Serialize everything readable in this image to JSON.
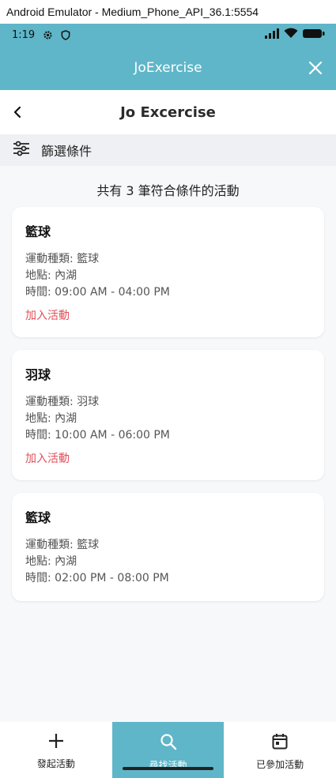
{
  "window": {
    "title": "Android Emulator - Medium_Phone_API_36.1:5554"
  },
  "statusbar": {
    "time": "1:19"
  },
  "appbar": {
    "title": "JoExercise"
  },
  "subheader": {
    "title": "Jo Excercise"
  },
  "filter": {
    "label": "篩選條件"
  },
  "results": {
    "count_text": "共有 3 筆符合條件的活動"
  },
  "activities": [
    {
      "title": "籃球",
      "sport": "運動種類: 籃球",
      "place": "地點: 內湖",
      "time": "時間: 09:00 AM - 04:00 PM",
      "join": "加入活動"
    },
    {
      "title": "羽球",
      "sport": "運動種類: 羽球",
      "place": "地點: 內湖",
      "time": "時間: 10:00 AM - 06:00 PM",
      "join": "加入活動"
    },
    {
      "title": "籃球",
      "sport": "運動種類: 籃球",
      "place": "地點: 內湖",
      "time": "時間: 02:00 PM - 08:00 PM"
    }
  ],
  "nav": {
    "items": [
      {
        "label": "發起活動",
        "icon": "plus-icon"
      },
      {
        "label": "尋找活動",
        "icon": "search-icon"
      },
      {
        "label": "已參加活動",
        "icon": "calendar-icon"
      }
    ]
  },
  "colors": {
    "primary": "#5fb6c8",
    "join": "#e0505a"
  }
}
